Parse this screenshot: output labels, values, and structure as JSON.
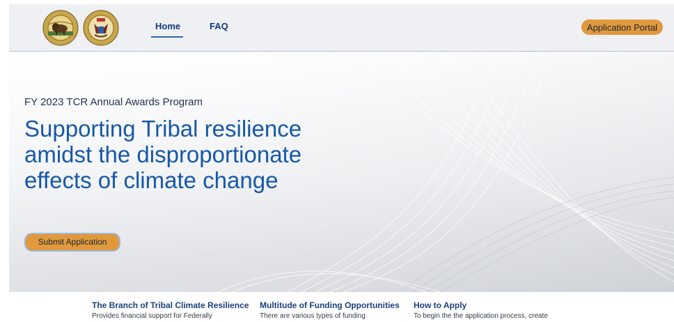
{
  "header": {
    "seals": [
      {
        "icon": "doi-seal-icon",
        "text": "U.S. DEPARTMENT OF THE INTERIOR · MARCH 3, 1849"
      },
      {
        "icon": "bia-seal-icon",
        "text": "BUREAU OF INDIAN AFFAIRS · 1824"
      }
    ],
    "nav": [
      {
        "label": "Home",
        "active": true
      },
      {
        "label": "FAQ",
        "active": false
      }
    ],
    "portal_label": "Application Portal"
  },
  "hero": {
    "eyebrow": "FY 2023 TCR Annual Awards Program",
    "headline": "Supporting Tribal resilience amidst the disproportionate effects of climate change",
    "cta_label": "Submit Application"
  },
  "features": [
    {
      "title": "The Branch of Tribal Climate Resilience",
      "text": "Provides financial support for Federally"
    },
    {
      "title": "Multitude of Funding Opportunities",
      "text": "There are various types of funding"
    },
    {
      "title": "How to Apply",
      "text": "To begin the the application process, create"
    }
  ],
  "colors": {
    "accent_orange": "#e09a3d",
    "headline_blue": "#1658a8",
    "nav_blue": "#123a78",
    "header_bg": "#eef0f3"
  }
}
